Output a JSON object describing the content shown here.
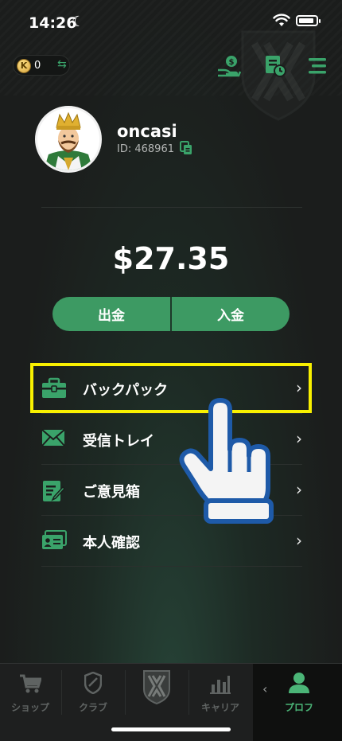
{
  "status_bar": {
    "time": "14:26"
  },
  "wallet": {
    "coin_symbol": "K",
    "coin_balance": "0"
  },
  "profile": {
    "username": "oncasi",
    "user_id": "ID: 468961"
  },
  "balance": {
    "amount": "$27.35"
  },
  "actions": {
    "withdraw_label": "出金",
    "deposit_label": "入金"
  },
  "menu": {
    "items": [
      {
        "label": "バックパック",
        "icon": "briefcase-icon"
      },
      {
        "label": "受信トレイ",
        "icon": "envelope-icon"
      },
      {
        "label": "ご意見箱",
        "icon": "feedback-icon"
      },
      {
        "label": "本人確認",
        "icon": "id-card-icon"
      }
    ]
  },
  "tabs": [
    {
      "label": "ショップ",
      "icon": "cart-icon"
    },
    {
      "label": "クラブ",
      "icon": "shield-icon"
    },
    {
      "label": "",
      "icon": "logo-icon"
    },
    {
      "label": "キャリア",
      "icon": "bar-chart-icon"
    },
    {
      "label": "プロフ",
      "icon": "person-icon"
    }
  ],
  "colors": {
    "accent": "#3d9a63",
    "highlight": "#f8f000",
    "active_tab": "#4bb577"
  }
}
